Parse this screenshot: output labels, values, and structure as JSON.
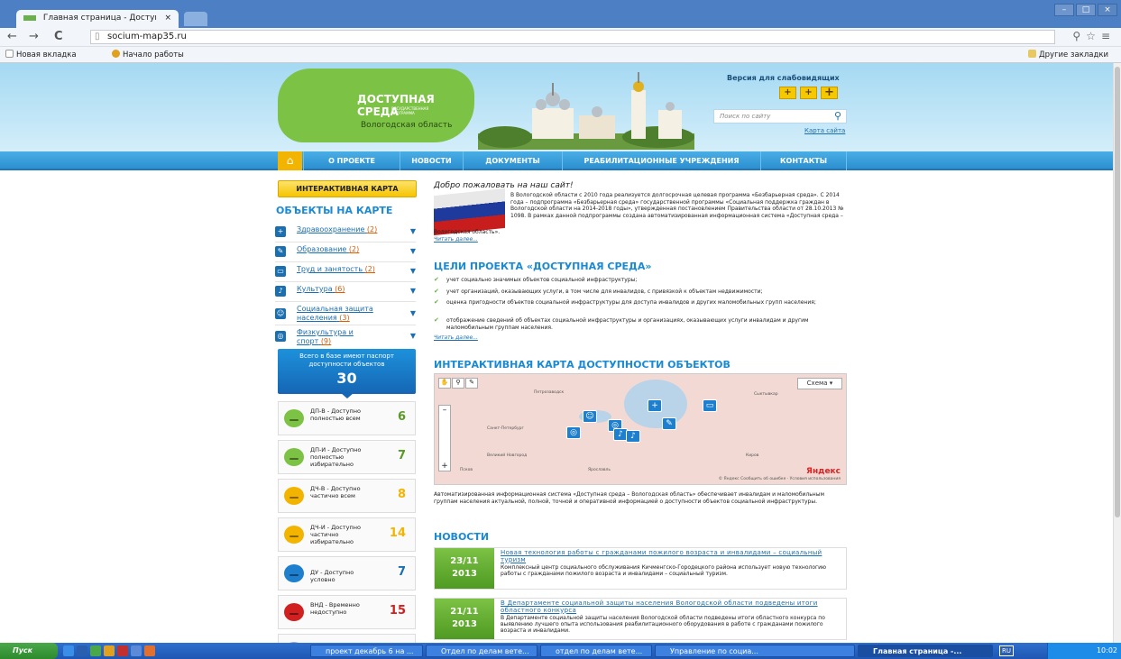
{
  "browser": {
    "tab_title": "Главная страница - Достуı",
    "tab_close": "×",
    "url": "socium-map35.ru",
    "back": "←",
    "forward": "→",
    "reload": "C",
    "bookmarks": [
      "Новая вкладка",
      "Начало работы"
    ],
    "other_bookmarks": "Другие закладки"
  },
  "header": {
    "logo_line1": "ДОСТУПНАЯ",
    "logo_line2": "СРЕДА",
    "logo_small": "ГОСУДАРСТВЕННАЯ ПРОГРАММА",
    "region": "Вологодская область",
    "vision_label": "Версия для слабовидящих",
    "vision_buttons": [
      "+",
      "+",
      "+"
    ],
    "search_placeholder": "Поиск по сайту",
    "sitemap": "Карта сайта"
  },
  "menu": {
    "items": [
      "О ПРОЕКТЕ",
      "НОВОСТИ",
      "ДОКУМЕНТЫ",
      "РЕАБИЛИТАЦИОННЫЕ УЧРЕЖДЕНИЯ",
      "КОНТАКТЫ"
    ]
  },
  "sidebar": {
    "map_button": "ИНТЕРАКТИВНАЯ КАРТА",
    "objects_title": "ОБЪЕКТЫ НА КАРТЕ",
    "categories": [
      {
        "label": "Здравоохранение",
        "count": "(2)",
        "icon": "plus-cross-icon"
      },
      {
        "label": "Образование",
        "count": "(2)",
        "icon": "pencil-icon"
      },
      {
        "label": "Труд и занятость",
        "count": "(2)",
        "icon": "briefcase-icon"
      },
      {
        "label": "Культура",
        "count": "(6)",
        "icon": "music-note-icon"
      },
      {
        "label": "Социальная защита населения",
        "count": "(3)",
        "icon": "people-icon"
      },
      {
        "label": "Физкультура и спорт",
        "count": "(9)",
        "icon": "ball-icon"
      }
    ],
    "total_text": "Всего в базе имеют паспорт доступности объектов",
    "total_value": "30",
    "statuses": [
      {
        "label": "ДП-В - Доступно полностью всем",
        "value": "6",
        "color": "#7cc245"
      },
      {
        "label": "ДП-И - Доступно полностью избирательно",
        "value": "7",
        "color": "#7cc245"
      },
      {
        "label": "ДЧ-В - Доступно частично всем",
        "value": "8",
        "color": "#f3b400"
      },
      {
        "label": "ДЧ-И - Доступно частично избирательно",
        "value": "14",
        "color": "#f3b400"
      },
      {
        "label": "ДУ - Доступно условно",
        "value": "7",
        "color": "#1d7fce"
      },
      {
        "label": "ВНД - Временно недоступно",
        "value": "15",
        "color": "#d02020"
      }
    ]
  },
  "welcome": {
    "heading": "Добро пожаловать на наш сайт!",
    "text": "В Вологодской области с 2010 года реализуется долгосрочная целевая программа «Безбарьерная среда». С 2014 года – подпрограмма «Безбарьерная среда» государственной программы «Социальная поддержка граждан в Вологодской области на 2014-2018 годы», утвержденная постановлением Правительства области от 28.10.2013 № 1098. В рамках данной подпрограммы создана автоматизированная информационная система «Доступная среда –",
    "text_end": "Вологодская область».",
    "more": "Читать далее..."
  },
  "goals": {
    "title": "ЦЕЛИ ПРОЕКТА «ДОСТУПНАЯ СРЕДА»",
    "items": [
      "учет социально значимых объектов социальной инфраструктуры;",
      "учет организаций, оказывающих услуги, в том числе для инвалидов, с привязкой к объектам недвижимости;",
      "оценка пригодности объектов социальной инфраструктуры для доступа инвалидов и других маломобильных групп населения;",
      "отображение сведений об объектах социальной инфраструктуры и организациях, оказывающих услуги инвалидам и другим маломобильным группам населения."
    ],
    "more": "Читать далее..."
  },
  "map_section": {
    "title": "ИНТЕРАКТИВНАЯ КАРТА ДОСТУПНОСТИ ОБЪЕКТОВ",
    "scheme": "Схема ▾",
    "towns": [
      "Петрозаводск",
      "Сыктывкар",
      "Санкт-Петербург",
      "Великий Новгород",
      "Ярославль",
      "Киров",
      "Псков"
    ],
    "copyright": "© Яндекс  Сообщить об ошибке · Условия использования",
    "yandex": "Яндекс",
    "description": "Автоматизированная информационная система «Доступная среда – Вологодская область» обеспечивает инвалидам и маломобильным группам населения актуальной, полной, точной и оперативной информацией о доступности объектов социальной инфраструктуры."
  },
  "news": {
    "title": "НОВОСТИ",
    "items": [
      {
        "date": "23/11",
        "year": "2013",
        "title": "Новая технология работы с гражданами пожилого возраста и инвалидами – социальный туризм",
        "body": "Комплексный центр социального обслуживания Кичменгско-Городецкого района использует новую технологию работы с гражданами пожилого возраста и инвалидами – социальный туризм."
      },
      {
        "date": "21/11",
        "year": "2013",
        "title": "В Департаменте социальной защиты населения Вологодской области подведены итоги областного конкурса",
        "body": "В Департаменте социальной защиты населения Вологодской области подведены итоги областного конкурса по выявлению лучшего опыта использования реабилитационного оборудования в работе с гражданами пожилого возраста и инвалидами."
      }
    ]
  },
  "taskbar": {
    "start": "Пуск",
    "tasks": [
      "проект декабрь 6 на ...",
      "Отдел по делам вете...",
      "отдел по делам вете...",
      "Управление по социа...",
      "Главная страница -..."
    ],
    "lang": "RU",
    "time": "10:02"
  }
}
